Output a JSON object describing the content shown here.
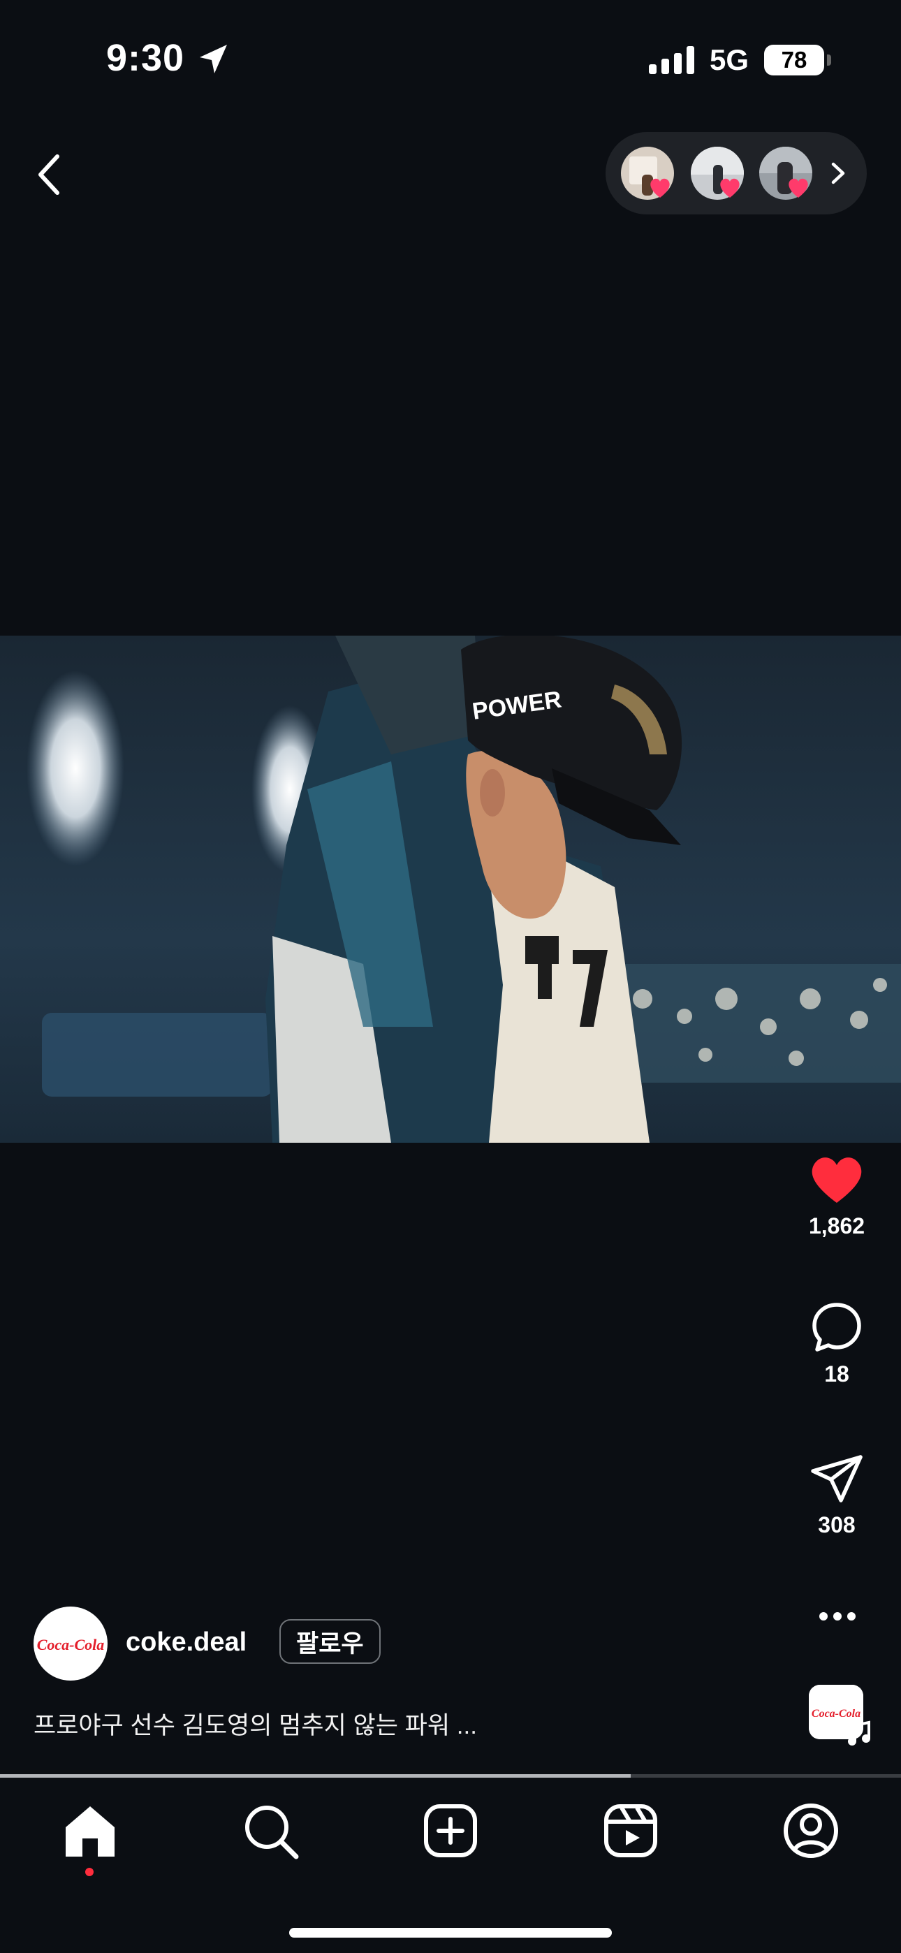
{
  "status": {
    "time": "9:30",
    "network": "5G",
    "battery": "78"
  },
  "post": {
    "username": "coke.deal",
    "follow_label": "팔로우",
    "caption": "프로야구 선수 김도영의 멈추지 않는 파워 ...",
    "brand_logo_text": "Coca-Cola",
    "helmet_text": "POWER"
  },
  "actions": {
    "likes": "1,862",
    "comments": "18",
    "shares": "308"
  },
  "playback": {
    "progress": 0.7
  },
  "colors": {
    "background": "#0b0e13",
    "like": "#ff2d3d",
    "coke_red": "#e41e2b"
  },
  "tabs": [
    "home",
    "search",
    "create",
    "reels",
    "profile"
  ]
}
